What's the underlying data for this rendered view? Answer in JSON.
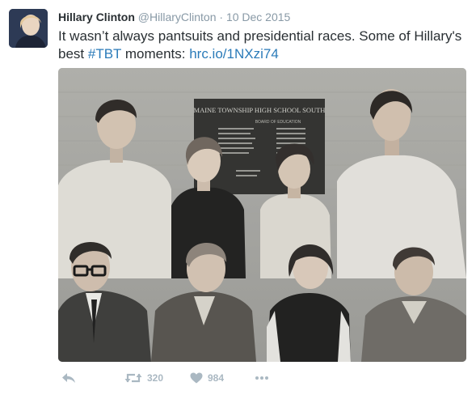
{
  "tweet": {
    "author_name": "Hillary Clinton",
    "handle": "@HillaryClinton",
    "separator": "·",
    "date": "10 Dec 2015",
    "text_before": "It wasn’t always pantsuits and presidential races. Some of Hillary's best ",
    "hashtag": "#TBT",
    "text_middle": " moments: ",
    "link": "hrc.io/1NXzi74"
  },
  "photo": {
    "plaque_title": "MAINE TOWNSHIP HIGH SCHOOL SOUTH",
    "plaque_subtitle": "BOARD OF EDUCATION"
  },
  "actions": {
    "retweet_count": "320",
    "like_count": "984",
    "icons": [
      "reply-icon",
      "retweet-icon",
      "heart-icon",
      "more-icon"
    ]
  },
  "colors": {
    "link": "#2b7bb9",
    "text": "#292f33",
    "meta": "#8899a6",
    "action": "#aab8c2"
  }
}
